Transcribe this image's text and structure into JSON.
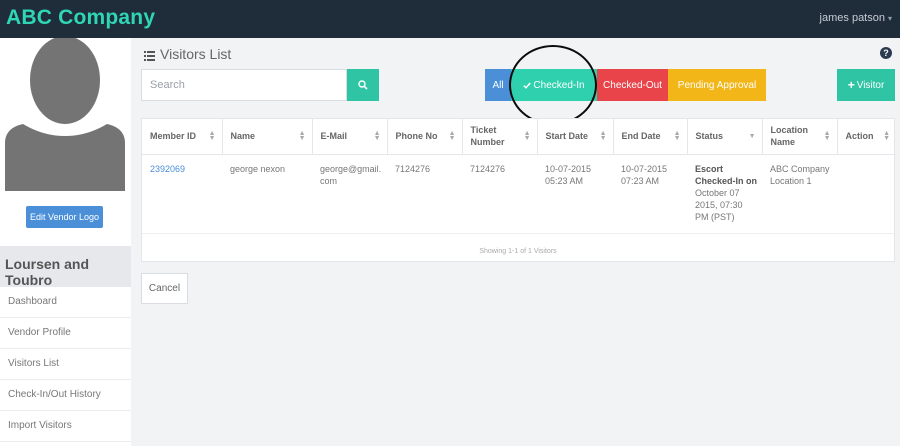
{
  "header": {
    "brand": "ABC Company",
    "user_name": "james patson",
    "user_caret": "▾"
  },
  "sidebar": {
    "edit_logo_label": "Edit Vendor Logo",
    "vendor_name": "Loursen and Toubro",
    "items": [
      {
        "label": "Dashboard"
      },
      {
        "label": "Vendor Profile"
      },
      {
        "label": "Visitors List"
      },
      {
        "label": "Check-In/Out History"
      },
      {
        "label": "Import Visitors"
      }
    ]
  },
  "main": {
    "title": "Visitors List",
    "help": "?",
    "search": {
      "placeholder": "Search",
      "value": ""
    },
    "filters": {
      "all": "All",
      "checked_in": "Checked-In",
      "checked_out": "Checked-Out",
      "pending": "Pending Approval"
    },
    "add_visitor": "Visitor",
    "table": {
      "columns": [
        "Member ID",
        "Name",
        "E-Mail",
        "Phone No",
        "Ticket Number",
        "Start Date",
        "End Date",
        "Status",
        "Location Name",
        "Action"
      ],
      "rows": [
        {
          "member_id": "2392069",
          "name": "george nexon",
          "email": "george@gmail.com",
          "phone": "7124276",
          "ticket": "7124276",
          "start": "10-07-2015 05:23 AM",
          "end": "10-07-2015 07:23 AM",
          "status_bold": "Escort Checked-In on",
          "status_rest": "October 07 2015, 07:30 PM (PST)",
          "location": "ABC Company Location 1",
          "action": ""
        }
      ],
      "footer": "Showing 1-1 of 1 Visitors"
    },
    "cancel_label": "Cancel"
  },
  "colors": {
    "topbar": "#1f2c3a",
    "brand": "#2fd6b4",
    "teal": "#2fc4a4",
    "blue": "#4a8fd8",
    "red": "#e8444a",
    "yellow": "#f3b618"
  }
}
